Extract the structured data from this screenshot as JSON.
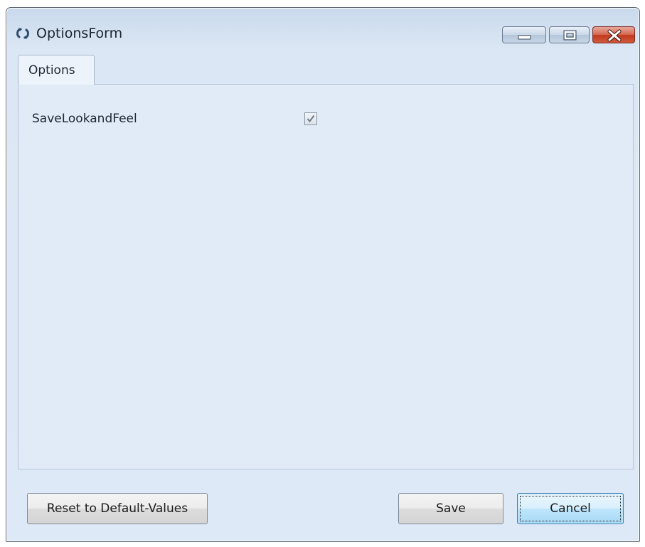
{
  "window": {
    "title": "OptionsForm",
    "icon": "refresh-icon",
    "controls": {
      "minimize": "minimize-icon",
      "maximize": "maximize-icon",
      "close": "close-icon"
    }
  },
  "tabs": [
    {
      "label": "Options",
      "selected": true
    }
  ],
  "options": [
    {
      "label": "SaveLookandFeel",
      "checked": true
    }
  ],
  "buttons": {
    "reset": "Reset to Default-Values",
    "save": "Save",
    "cancel": "Cancel"
  },
  "colors": {
    "window_bg": "#dde9f6",
    "close_button": "#c3391d",
    "cancel_focus": "#3c7fb1"
  }
}
